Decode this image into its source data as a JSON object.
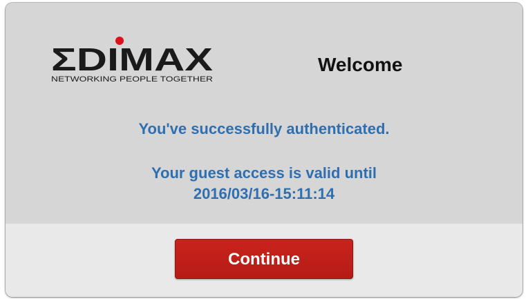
{
  "brand": {
    "logo_name": "EDIMAX",
    "tagline": "NETWORKING PEOPLE TOGETHER"
  },
  "header": {
    "title": "Welcome"
  },
  "message": {
    "success": "You've successfully authenticated.",
    "valid_until_label": "Your guest access is valid until",
    "valid_until_time": "2016/03/16-15:11:14"
  },
  "footer": {
    "continue_label": "Continue"
  },
  "colors": {
    "message_text": "#2f6fb0",
    "button": "#c21f19",
    "logo_dot": "#e0101a",
    "panel": "#d6d6d6",
    "footer": "#e9e9e9"
  }
}
